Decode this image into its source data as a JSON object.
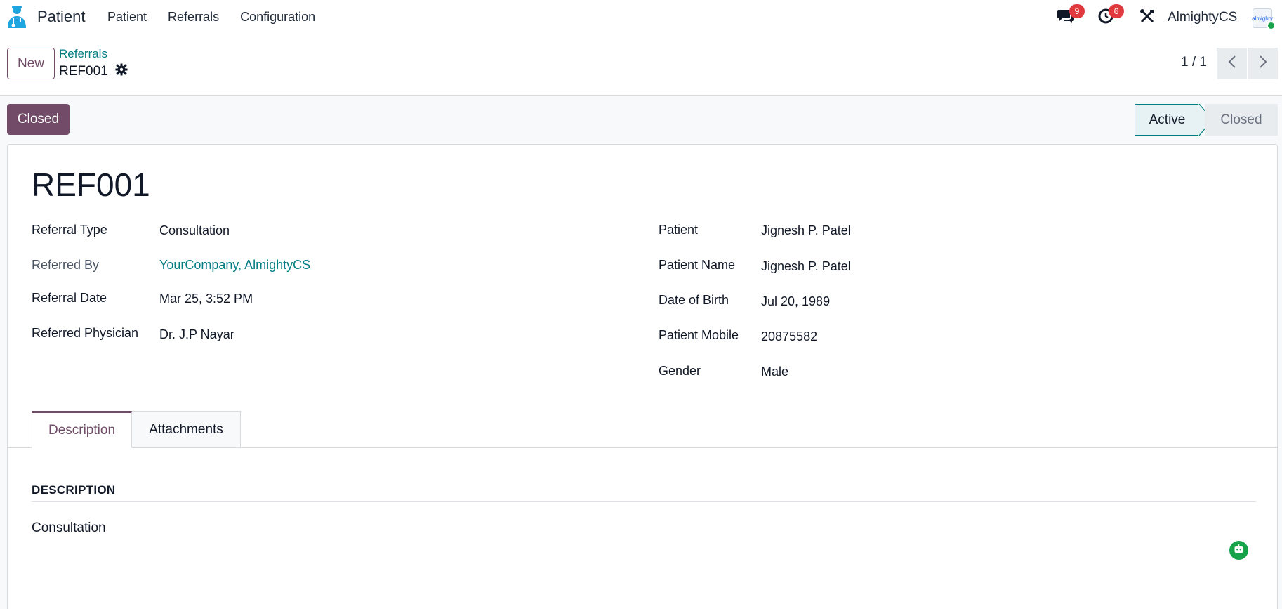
{
  "navbar": {
    "app_name": "Patient",
    "menu": [
      "Patient",
      "Referrals",
      "Configuration"
    ],
    "messages_count": "9",
    "activities_count": "6",
    "user_name": "AlmightyCS",
    "avatar_text": "almighty"
  },
  "control": {
    "new_label": "New",
    "breadcrumb_parent": "Referrals",
    "breadcrumb_current": "REF001",
    "pager_value": "1 / 1"
  },
  "status": {
    "closed_button": "Closed",
    "stages": [
      "Active",
      "Closed"
    ],
    "current_stage": "Active"
  },
  "form": {
    "title": "REF001",
    "left_fields": [
      {
        "label": "Referral Type",
        "value": "Consultation"
      },
      {
        "label": "Referred By",
        "value": "YourCompany, AlmightyCS"
      },
      {
        "label": "Referral Date",
        "value": "Mar 25, 3:52 PM"
      },
      {
        "label": "Referred Physician",
        "value": "Dr. J.P Nayar"
      }
    ],
    "right_fields": [
      {
        "label": "Patient",
        "value": "Jignesh P. Patel"
      },
      {
        "label": "Patient Name",
        "value": "Jignesh P. Patel"
      },
      {
        "label": "Date of Birth",
        "value": "Jul 20, 1989"
      },
      {
        "label": "Patient Mobile",
        "value": "20875582"
      },
      {
        "label": "Gender",
        "value": "Male"
      }
    ],
    "tabs": [
      "Description",
      "Attachments"
    ],
    "section_title": "DESCRIPTION",
    "description": "Consultation"
  },
  "colors": {
    "brand": "#714b67",
    "link": "#017e84",
    "badge": "#e03a3e",
    "online": "#16a34a"
  },
  "icons": [
    "patient-app-icon",
    "chat-icon",
    "clock-icon",
    "tools-icon",
    "gear-icon",
    "chevron-left-icon",
    "chevron-right-icon",
    "bot-icon"
  ]
}
